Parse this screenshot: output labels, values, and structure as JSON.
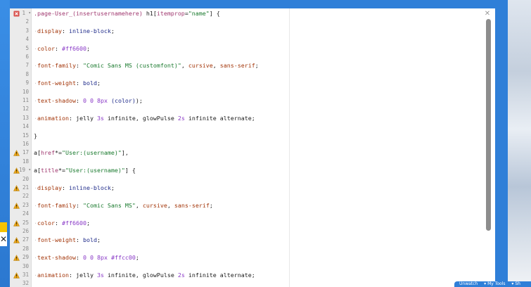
{
  "editor": {
    "lines": [
      {
        "num": "1",
        "fold": true,
        "marker": "error",
        "tokens": [
          {
            "c": "t-sel",
            "t": ".page-User_(insertusernamehere)"
          },
          {
            "c": "",
            "t": " h1["
          },
          {
            "c": "t-sel",
            "t": "itemprop"
          },
          {
            "c": "",
            "t": "="
          },
          {
            "c": "t-str",
            "t": "\"name\""
          },
          {
            "c": "",
            "t": "] {"
          }
        ]
      },
      {
        "num": "2",
        "tokens": []
      },
      {
        "num": "3",
        "tokens": [
          {
            "c": "t-ind",
            "t": "·"
          },
          {
            "c": "t-kw",
            "t": "display"
          },
          {
            "c": "",
            "t": ": "
          },
          {
            "c": "t-val",
            "t": "inline-block"
          },
          {
            "c": "",
            "t": ";"
          }
        ]
      },
      {
        "num": "4",
        "tokens": []
      },
      {
        "num": "5",
        "tokens": [
          {
            "c": "t-ind",
            "t": "·"
          },
          {
            "c": "t-kw",
            "t": "color"
          },
          {
            "c": "",
            "t": ": "
          },
          {
            "c": "t-num",
            "t": "#ff6600"
          },
          {
            "c": "",
            "t": ";"
          }
        ]
      },
      {
        "num": "6",
        "tokens": []
      },
      {
        "num": "7",
        "tokens": [
          {
            "c": "t-ind",
            "t": "·"
          },
          {
            "c": "t-kw",
            "t": "font-family"
          },
          {
            "c": "",
            "t": ": "
          },
          {
            "c": "t-str",
            "t": "\"Comic Sans MS (customfont)\""
          },
          {
            "c": "",
            "t": ", "
          },
          {
            "c": "t-kw",
            "t": "cursive"
          },
          {
            "c": "",
            "t": ", "
          },
          {
            "c": "t-kw",
            "t": "sans-serif"
          },
          {
            "c": "",
            "t": ";"
          }
        ]
      },
      {
        "num": "8",
        "tokens": []
      },
      {
        "num": "9",
        "tokens": [
          {
            "c": "t-ind",
            "t": "·"
          },
          {
            "c": "t-kw",
            "t": "font-weight"
          },
          {
            "c": "",
            "t": ": "
          },
          {
            "c": "t-val",
            "t": "bold"
          },
          {
            "c": "",
            "t": ";"
          }
        ]
      },
      {
        "num": "10",
        "tokens": []
      },
      {
        "num": "11",
        "tokens": [
          {
            "c": "t-ind",
            "t": "·"
          },
          {
            "c": "t-kw",
            "t": "text-shadow"
          },
          {
            "c": "",
            "t": ": "
          },
          {
            "c": "t-num",
            "t": "0"
          },
          {
            "c": "",
            "t": " "
          },
          {
            "c": "t-num",
            "t": "0"
          },
          {
            "c": "",
            "t": " "
          },
          {
            "c": "t-num",
            "t": "8px"
          },
          {
            "c": "",
            "t": " "
          },
          {
            "c": "t-val",
            "t": "(color)"
          },
          {
            "c": "",
            "t": ");"
          }
        ]
      },
      {
        "num": "12",
        "tokens": []
      },
      {
        "num": "13",
        "tokens": [
          {
            "c": "t-ind",
            "t": "·"
          },
          {
            "c": "t-kw",
            "t": "animation"
          },
          {
            "c": "",
            "t": ": jelly "
          },
          {
            "c": "t-num",
            "t": "3s"
          },
          {
            "c": "",
            "t": " infinite, glowPulse "
          },
          {
            "c": "t-num",
            "t": "2s"
          },
          {
            "c": "",
            "t": " infinite alternate;"
          }
        ]
      },
      {
        "num": "14",
        "tokens": []
      },
      {
        "num": "15",
        "tokens": [
          {
            "c": "",
            "t": "}"
          }
        ]
      },
      {
        "num": "16",
        "tokens": []
      },
      {
        "num": "17",
        "marker": "warning",
        "tokens": [
          {
            "c": "",
            "t": "a["
          },
          {
            "c": "t-sel",
            "t": "href"
          },
          {
            "c": "",
            "t": "*="
          },
          {
            "c": "t-str",
            "t": "\"User:(username)\""
          },
          {
            "c": "",
            "t": "],"
          }
        ]
      },
      {
        "num": "18",
        "tokens": []
      },
      {
        "num": "19",
        "fold": true,
        "marker": "warning",
        "tokens": [
          {
            "c": "",
            "t": "a["
          },
          {
            "c": "t-sel",
            "t": "title"
          },
          {
            "c": "",
            "t": "*="
          },
          {
            "c": "t-str",
            "t": "\"User:(username)\""
          },
          {
            "c": "",
            "t": "] {"
          }
        ]
      },
      {
        "num": "20",
        "tokens": []
      },
      {
        "num": "21",
        "marker": "warning",
        "tokens": [
          {
            "c": "t-ind",
            "t": "·"
          },
          {
            "c": "t-kw",
            "t": "display"
          },
          {
            "c": "",
            "t": ": "
          },
          {
            "c": "t-val",
            "t": "inline-block"
          },
          {
            "c": "",
            "t": ";"
          }
        ]
      },
      {
        "num": "22",
        "tokens": []
      },
      {
        "num": "23",
        "marker": "warning",
        "tokens": [
          {
            "c": "t-ind",
            "t": "·"
          },
          {
            "c": "t-kw",
            "t": "font-family"
          },
          {
            "c": "",
            "t": ": "
          },
          {
            "c": "t-str",
            "t": "\"Comic Sans MS\""
          },
          {
            "c": "",
            "t": ", "
          },
          {
            "c": "t-kw",
            "t": "cursive"
          },
          {
            "c": "",
            "t": ", "
          },
          {
            "c": "t-kw",
            "t": "sans-serif"
          },
          {
            "c": "",
            "t": ";"
          }
        ]
      },
      {
        "num": "24",
        "tokens": []
      },
      {
        "num": "25",
        "marker": "warning",
        "tokens": [
          {
            "c": "t-ind",
            "t": "·"
          },
          {
            "c": "t-kw",
            "t": "color"
          },
          {
            "c": "",
            "t": ": "
          },
          {
            "c": "t-num",
            "t": "#ff6600"
          },
          {
            "c": "",
            "t": ";"
          }
        ]
      },
      {
        "num": "26",
        "tokens": []
      },
      {
        "num": "27",
        "marker": "warning",
        "tokens": [
          {
            "c": "t-ind",
            "t": "·"
          },
          {
            "c": "t-kw",
            "t": "font-weight"
          },
          {
            "c": "",
            "t": ": "
          },
          {
            "c": "t-val",
            "t": "bold"
          },
          {
            "c": "",
            "t": ";"
          }
        ]
      },
      {
        "num": "28",
        "tokens": []
      },
      {
        "num": "29",
        "marker": "warning",
        "tokens": [
          {
            "c": "t-ind",
            "t": "·"
          },
          {
            "c": "t-kw",
            "t": "text-shadow"
          },
          {
            "c": "",
            "t": ": "
          },
          {
            "c": "t-num",
            "t": "0"
          },
          {
            "c": "",
            "t": " "
          },
          {
            "c": "t-num",
            "t": "0"
          },
          {
            "c": "",
            "t": " "
          },
          {
            "c": "t-num",
            "t": "8px"
          },
          {
            "c": "",
            "t": " "
          },
          {
            "c": "t-num",
            "t": "#ffcc00"
          },
          {
            "c": "",
            "t": ";"
          }
        ]
      },
      {
        "num": "30",
        "tokens": []
      },
      {
        "num": "31",
        "marker": "warning",
        "tokens": [
          {
            "c": "t-ind",
            "t": "·"
          },
          {
            "c": "t-kw",
            "t": "animation"
          },
          {
            "c": "",
            "t": ": jelly "
          },
          {
            "c": "t-num",
            "t": "3s"
          },
          {
            "c": "",
            "t": " infinite, glowPulse "
          },
          {
            "c": "t-num",
            "t": "2s"
          },
          {
            "c": "",
            "t": " infinite alternate;"
          }
        ]
      },
      {
        "num": "32",
        "tokens": []
      }
    ],
    "close_icon": "close-icon",
    "fold_glyph": "▾",
    "scroll_position": 0.0
  },
  "left_panel": {
    "close_glyph": "✕"
  },
  "bottom_bar": {
    "item1": "Unwatch",
    "item2": "▾ My Tools",
    "item3": "▾ Sh"
  },
  "colors": {
    "error": "#d9534f",
    "warning": "#e8a317",
    "accent": "#2f7fd8"
  }
}
